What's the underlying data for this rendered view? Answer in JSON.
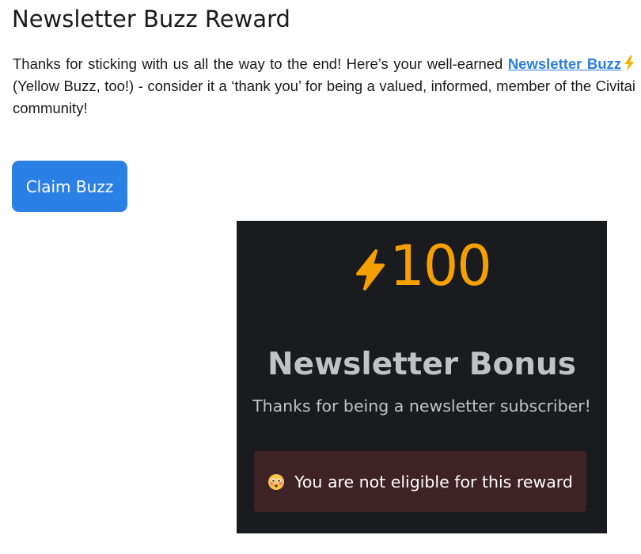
{
  "page": {
    "title": "Newsletter Buzz Reward",
    "intro_before_link": "Thanks for sticking with us all the way to the end! Here’s your well-earned ",
    "intro_link": "Newsletter Buzz",
    "intro_after_link": " (Yellow Buzz, too!) - consider it a ‘thank you’ for being a valued, informed, member of the Civitai community!",
    "claim_button_label": "Claim Buzz"
  },
  "reward_card": {
    "amount": "100",
    "title": "Newsletter Bonus",
    "subtitle": "Thanks for being a newsletter subscriber!",
    "alert_text": "You are not eligible for this reward"
  },
  "icons": {
    "bolt": "lightning-bolt-icon",
    "alert": "face-emoji-icon"
  },
  "colors": {
    "accent_blue": "#2b80e6",
    "link_blue": "#2c7de0",
    "buzz_yellow": "#f59f00",
    "card_bg": "#1a1b1e",
    "alert_bg": "#3f2225",
    "muted_text": "#c1c2c5"
  }
}
